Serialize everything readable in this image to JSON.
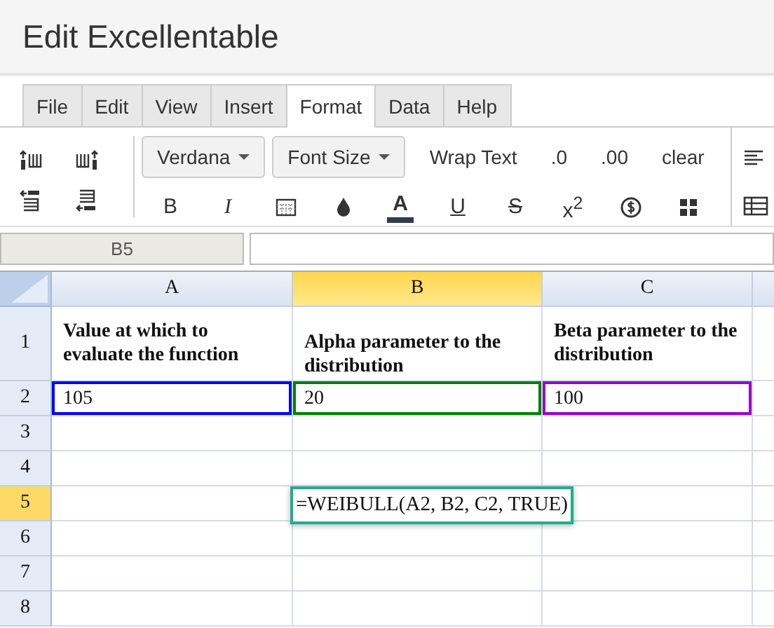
{
  "window": {
    "title": "Edit Excellentable"
  },
  "tabs": [
    {
      "label": "File",
      "selected": false
    },
    {
      "label": "Edit",
      "selected": false
    },
    {
      "label": "View",
      "selected": false
    },
    {
      "label": "Insert",
      "selected": false
    },
    {
      "label": "Format",
      "selected": true
    },
    {
      "label": "Data",
      "selected": false
    },
    {
      "label": "Help",
      "selected": false
    }
  ],
  "toolbar": {
    "dropdowns": [
      "Verdana",
      "Font Size"
    ],
    "text_buttons": [
      "Wrap Text",
      ".0",
      ".00",
      "clear"
    ],
    "format_buttons": [
      {
        "kind": "bold",
        "label": "B"
      },
      {
        "kind": "italic",
        "label": "I"
      },
      {
        "kind": "borders"
      },
      {
        "kind": "fill"
      },
      {
        "kind": "font-color",
        "label": "A"
      },
      {
        "kind": "underline",
        "label": "U"
      },
      {
        "kind": "strike",
        "label": "S"
      },
      {
        "kind": "superscript",
        "label": "x$^{2}$"
      },
      {
        "kind": "currency"
      },
      {
        "kind": "merge"
      }
    ]
  },
  "name_box": "B5",
  "grid": {
    "columns": [
      {
        "label": "A",
        "selected": false
      },
      {
        "label": "B",
        "selected": true
      },
      {
        "label": "C",
        "selected": false
      }
    ],
    "rows": [
      {
        "label": "1",
        "selected": false,
        "cells": [
          {
            "text": "Value at which to evaluate the function",
            "bold": true
          },
          {
            "text": "Alpha parameter to the distribution",
            "bold": true
          },
          {
            "text": "Beta parameter to the distribution",
            "bold": true
          }
        ]
      },
      {
        "label": "2",
        "selected": false,
        "cells": [
          {
            "text": "105",
            "color": "#0000ff"
          },
          {
            "text": "20",
            "color": "#008000"
          },
          {
            "text": "100",
            "color": "#9400d3"
          }
        ]
      },
      {
        "label": "3",
        "selected": false,
        "cells": []
      },
      {
        "label": "4",
        "selected": false,
        "cells": []
      },
      {
        "label": "5",
        "selected": true,
        "cells": []
      },
      {
        "label": "6",
        "selected": false,
        "cells": []
      },
      {
        "label": "7",
        "selected": false,
        "cells": []
      },
      {
        "label": "8",
        "selected": false,
        "cells": []
      }
    ],
    "editor": {
      "value": "=WEIBULL(A2, B2, C2, TRUE)"
    }
  }
}
